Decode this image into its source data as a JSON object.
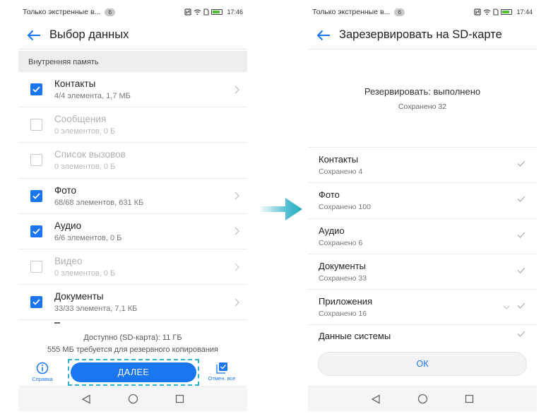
{
  "left": {
    "status": {
      "carrier": "Только экстренные в...",
      "badge": "6",
      "time": "17:46"
    },
    "title": "Выбор данных",
    "section_label": "Внутренняя память",
    "items": [
      {
        "name": "Контакты",
        "sub": "4/4 элемента, 1,7 МБ",
        "checked": true
      },
      {
        "name": "Сообщения",
        "sub": "0 элементов, 0 Б",
        "checked": false
      },
      {
        "name": "Список вызовов",
        "sub": "0 элементов, 0 Б",
        "checked": false
      },
      {
        "name": "Фото",
        "sub": "68/68 элементов, 631 КБ",
        "checked": true
      },
      {
        "name": "Аудио",
        "sub": "6/6 элементов, 0 Б",
        "checked": true
      },
      {
        "name": "Видео",
        "sub": "0 элементов, 0 Б",
        "checked": false
      },
      {
        "name": "Документы",
        "sub": "33/33 элемента, 7,1 КБ",
        "checked": true
      }
    ],
    "available": "Доступно (SD-карта): 11 ГБ",
    "required": "555 МБ требуется для резервного копирования",
    "help_label": "Справка",
    "next_label": "ДАЛЕЕ",
    "select_all_label": "Отмен. все"
  },
  "right": {
    "status": {
      "carrier": "Только экстренные в...",
      "badge": "6",
      "time": "17:44"
    },
    "title": "Зарезервировать на SD-карте",
    "result_title": "Резервировать: выполнено",
    "result_sub": "Сохранено 32",
    "items": [
      {
        "name": "Контакты",
        "sub": "Сохранено 4"
      },
      {
        "name": "Фото",
        "sub": "Сохранено 100"
      },
      {
        "name": "Аудио",
        "sub": "Сохранено 6"
      },
      {
        "name": "Документы",
        "sub": "Сохранено 33"
      },
      {
        "name": "Приложения",
        "sub": "Сохранено 16"
      },
      {
        "name": "Данные системы",
        "sub": ""
      }
    ],
    "ok_label": "ОК"
  },
  "colors": {
    "accent": "#1976f0",
    "highlight": "#2fb2c7"
  }
}
